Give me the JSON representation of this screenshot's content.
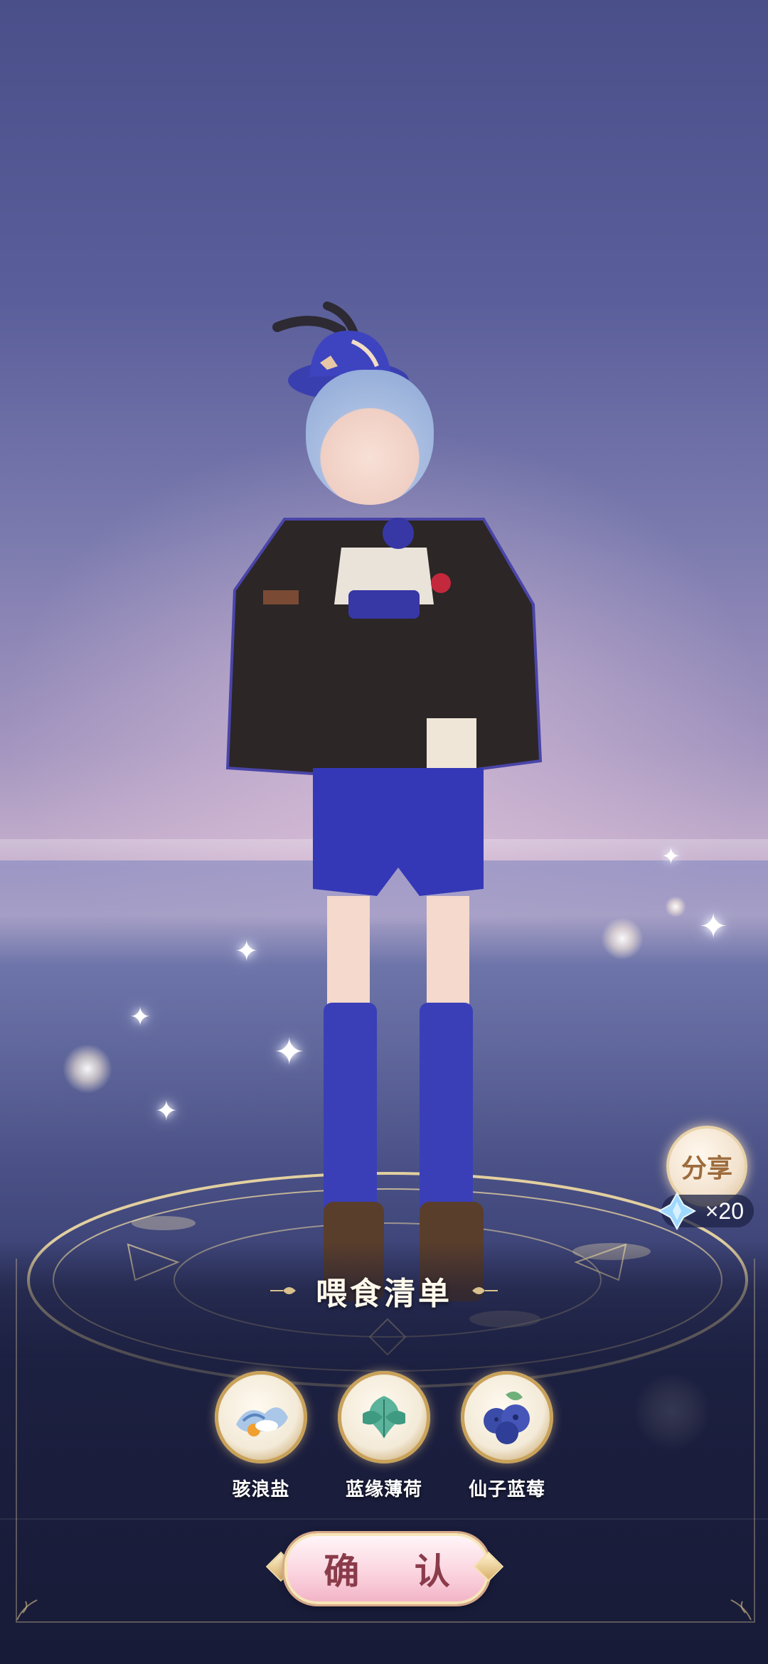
{
  "feed_panel": {
    "title": "喂食清单",
    "items": [
      {
        "name": "骇浪盐",
        "icon": "salt-wave-icon"
      },
      {
        "name": "蓝缘薄荷",
        "icon": "mint-leaf-icon"
      },
      {
        "name": "仙子蓝莓",
        "icon": "blueberry-icon"
      }
    ],
    "confirm_label": "确 认"
  },
  "share": {
    "label": "分享",
    "reward_count": "×20",
    "reward_icon": "blue-crystal-icon"
  },
  "colors": {
    "panel_bg": "#16193a",
    "gold": "#c9a25a",
    "confirm_text": "#8a3b4a"
  }
}
